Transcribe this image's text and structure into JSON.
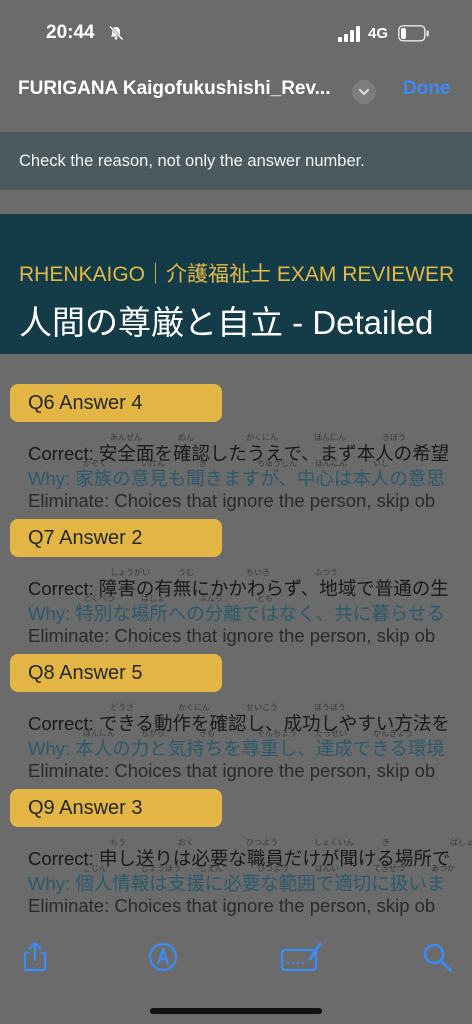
{
  "status_bar": {
    "time": "20:44",
    "network": "4G"
  },
  "nav": {
    "title": "FURIGANA Kaigofukushishi_Rev...",
    "done_label": "Done"
  },
  "banner": {
    "text": "Check the reason, not only the answer number."
  },
  "header": {
    "brand": "RHENKAIGO｜介護福祉士 EXAM REVIEWER",
    "title": "人間の尊厳と自立 - Detailed"
  },
  "questions": [
    {
      "pill": "Q6  Answer 4",
      "correct": "Correct: 安全面を確認したうえで、まず本人の希望",
      "why": "Why: 家族の意見も聞きますが、中心は本人の意思",
      "eliminate": "Eliminate: Choices that ignore the person, skip ob",
      "ruby_correct": [
        "あんぜん",
        "めん",
        "かくにん",
        "ほんにん",
        "きぼう"
      ],
      "ruby_why": [
        "かぞく",
        "いけん",
        "き",
        "ちゅうしん",
        "ほんにん",
        "いし"
      ]
    },
    {
      "pill": "Q7  Answer 2",
      "correct": "Correct: 障害の有無にかかわらず、地域で普通の生",
      "why": "Why: 特別な場所への分離ではなく、共に暮らせる",
      "eliminate": "Eliminate: Choices that ignore the person, skip ob",
      "ruby_correct": [
        "しょうがい",
        "うむ",
        "ちいき",
        "ふつう"
      ],
      "ruby_why": [
        "とくべつ",
        "ばしょ",
        "ぶんり",
        "とも"
      ]
    },
    {
      "pill": "Q8  Answer 5",
      "correct": "Correct: できる動作を確認し、成功しやすい方法を",
      "why": "Why: 本人の力と気持ちを尊重し、達成できる環境",
      "eliminate": "Eliminate: Choices that ignore the person, skip ob",
      "ruby_correct": [
        "どうさ",
        "かくにん",
        "せいこう",
        "ほうほう"
      ],
      "ruby_why": [
        "ほんにん",
        "ちから",
        "きも",
        "そんちょう",
        "たっせい",
        "かんきょう"
      ]
    },
    {
      "pill": "Q9  Answer 3",
      "correct": "Correct: 申し送りは必要な職員だけが聞ける場所で",
      "why": "Why: 個人情報は支援に必要な範囲で適切に扱いま",
      "eliminate": "Eliminate: Choices that ignore the person, skip ob",
      "ruby_correct": [
        "もう",
        "おく",
        "ひつよう",
        "しょくいん",
        "き",
        "ばしょ"
      ],
      "ruby_why": [
        "こじん",
        "じょうほう",
        "しえん",
        "ひつよう",
        "はんい",
        "てきせつ",
        "あつか"
      ]
    }
  ],
  "toolbar": {
    "items": [
      "share-icon",
      "markup-icon",
      "signature-icon",
      "search-icon"
    ]
  },
  "colors": {
    "accent": "#3b8cf6",
    "pill": "#e3b544",
    "header_bg": "#133c48",
    "why_text": "#2c5a6b"
  }
}
